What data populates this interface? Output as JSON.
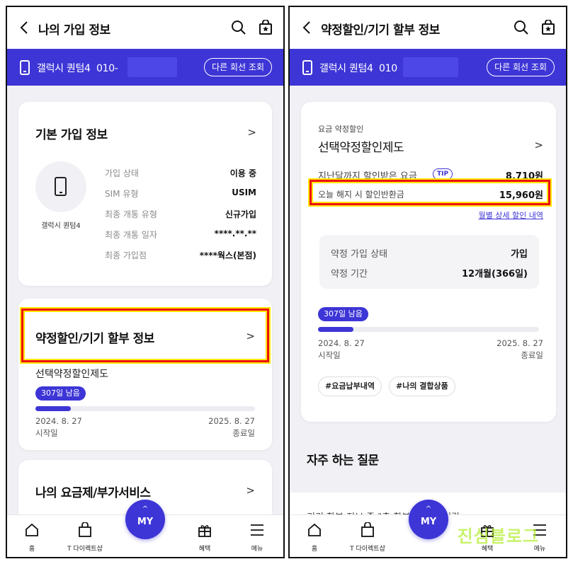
{
  "left": {
    "header": {
      "title": "나의 가입 정보"
    },
    "line": {
      "device": "갤럭시 퀀텀4",
      "number": "010-",
      "other_line_button": "다른 회선 조회"
    },
    "basic_info": {
      "title": "기본 가입 정보",
      "device_name": "갤럭시 퀀텀4",
      "rows": [
        {
          "label": "가입 상태",
          "value": "이용 중"
        },
        {
          "label": "SIM 유형",
          "value": "USIM"
        },
        {
          "label": "최종 개통 유형",
          "value": "신규가입"
        },
        {
          "label": "최종 개통 일자",
          "value": "****.**.**"
        },
        {
          "label": "최종 가입점",
          "value": "****웍스(본점)"
        }
      ]
    },
    "discount": {
      "title": "약정할인/기기 할부 정보",
      "plan": "선택약정할인제도",
      "remaining": "307일 남음",
      "progress": 0.16,
      "start_date": "2024. 8. 27",
      "start_label": "시작일",
      "end_date": "2025. 8. 27",
      "end_label": "종료일"
    },
    "plan_card": {
      "title": "나의 요금제/부가서비스"
    }
  },
  "right": {
    "header": {
      "title": "약정할인/기기 할부 정보"
    },
    "line": {
      "device": "갤럭시 퀀텀4",
      "number": "010",
      "other_line_button": "다른 회선 조회"
    },
    "contract": {
      "overline": "요금 약정할인",
      "title": "선택약정할인제도",
      "received_label": "지난달까지 할인받은 요금",
      "tip": "TIP",
      "received_value": "8,710원",
      "refund_label": "오늘 해지 시 할인반환금",
      "refund_value": "15,960원",
      "monthly_link": "월별 상세 할인 내역",
      "status_label": "약정 가입 상태",
      "status_value": "가입",
      "period_label": "약정 기간",
      "period_value": "12개월(366일)",
      "remaining": "307일 남음",
      "progress": 0.16,
      "start_date": "2024. 8. 27",
      "start_label": "시작일",
      "end_date": "2025. 8. 27",
      "end_label": "종료일",
      "tags": [
        "#요금납부내역",
        "#나의 결합상품"
      ]
    },
    "faq": {
      "title": "자주 하는 질문",
      "peek": "기기 할부 정보 중 \"총 할부 원금액\"이란"
    }
  },
  "tabbar": {
    "home": "홈",
    "tdirect": "T 다이렉트샵",
    "my_caret": "^",
    "my": "MY",
    "benefit": "혜택",
    "menu": "메뉴"
  },
  "watermark": "진심블로그",
  "colors": {
    "accent": "#3d35d6",
    "highlight_border": "#e11111",
    "highlight_glow": "#ffe600"
  }
}
